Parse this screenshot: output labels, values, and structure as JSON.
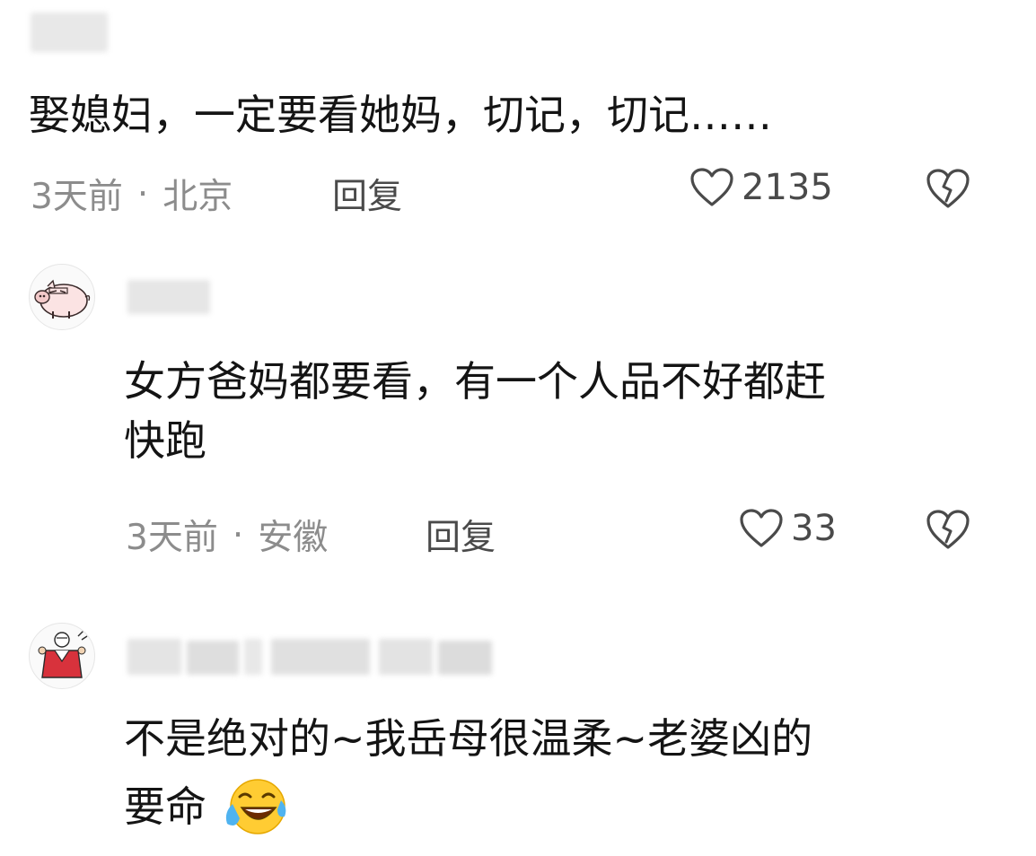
{
  "comments": [
    {
      "text": "娶媳妇，一定要看她妈，切记，切记……",
      "time": "3天前",
      "separator": "·",
      "location": "北京",
      "reply_label": "回复",
      "like_count": "2135"
    },
    {
      "text": "女方爸妈都要看，有一个人品不好都赶\n快跑",
      "time": "3天前",
      "separator": "·",
      "location": "安徽",
      "reply_label": "回复",
      "like_count": "33"
    },
    {
      "text_line1": "不是绝对的~我岳母很温柔~老婆凶的",
      "text_line2": "要命"
    }
  ],
  "icons": {
    "like": "heart-outline-icon",
    "dislike": "broken-heart-icon",
    "emoji": "laughing-crying-emoji"
  },
  "colors": {
    "text": "#141414",
    "meta": "#8c8c8c",
    "icon": "#4a4a4a"
  }
}
